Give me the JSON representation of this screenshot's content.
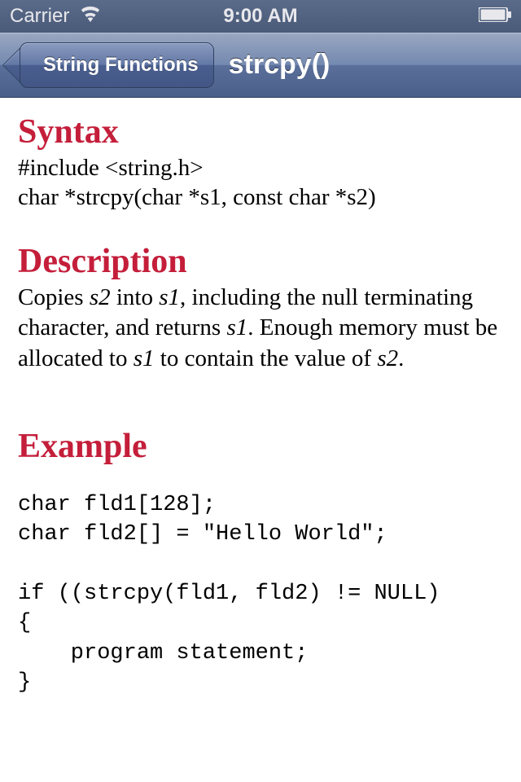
{
  "statusBar": {
    "carrier": "Carrier",
    "time": "9:00 AM"
  },
  "navBar": {
    "backLabel": "String Functions",
    "title": "strcpy()"
  },
  "sections": {
    "syntax": {
      "heading": "Syntax",
      "line1": "#include <string.h>",
      "line2": "char *strcpy(char *s1, const char *s2)"
    },
    "description": {
      "heading": "Description",
      "text_prefix": "Copies ",
      "var1": "s2",
      "text_mid1": " into ",
      "var2": "s1",
      "text_mid2": ", including the null terminating character, and returns ",
      "var3": "s1",
      "text_mid3": ". Enough memory must be allocated to ",
      "var4": "s1",
      "text_mid4": " to contain the value of ",
      "var5": "s2",
      "text_suffix": "."
    },
    "example": {
      "heading": "Example",
      "code": "char fld1[128];\nchar fld2[] = \"Hello World\";\n\nif ((strcpy(fld1, fld2) != NULL)\n{\n    program statement;\n}"
    }
  }
}
